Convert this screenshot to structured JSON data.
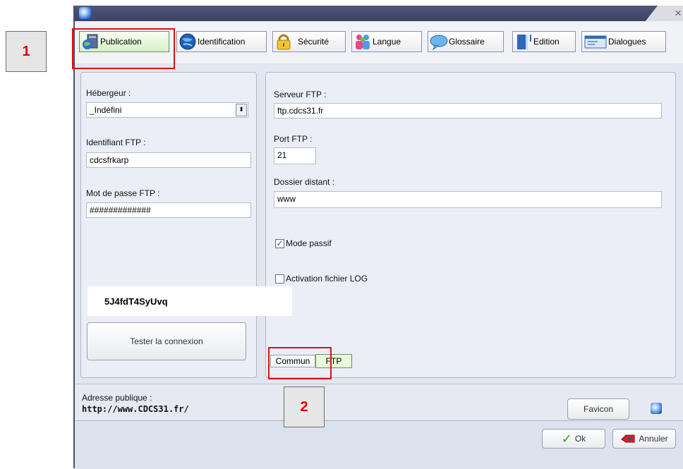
{
  "callouts": {
    "one": "1",
    "two": "2"
  },
  "window": {
    "close_glyph": "×"
  },
  "tabs": [
    {
      "label": "Publication",
      "icon": "publication-icon"
    },
    {
      "label": "Identification",
      "icon": "globe-icon"
    },
    {
      "label": "Sécurité",
      "icon": "lock-icon"
    },
    {
      "label": "Langue",
      "icon": "people-icon"
    },
    {
      "label": "Glossaire",
      "icon": "speech-bubble-icon"
    },
    {
      "label": "Edition",
      "icon": "edit-icon"
    },
    {
      "label": "Dialogues",
      "icon": "dialog-icon"
    }
  ],
  "left_panel": {
    "host_label": "Hébergeur :",
    "host_value": "_Indéfini",
    "ftp_id_label": "Identifiant FTP :",
    "ftp_id_value": "cdcsfrkarp",
    "ftp_pass_label": "Mot de passe FTP :",
    "ftp_pass_value": "#############",
    "overlay_code": "5J4fdT4SyUvq",
    "test_button": "Tester la connexion"
  },
  "right_panel": {
    "server_label": "Serveur FTP :",
    "server_value": "ftp.cdcs31.fr",
    "port_label": "Port FTP :",
    "port_value": "21",
    "folder_label": "Dossier distant :",
    "folder_value": "www",
    "passive_label": "Mode passif",
    "passive_checked": true,
    "log_label": "Activation fichier LOG",
    "log_checked": false
  },
  "subtabs": [
    "Commun",
    "FTP"
  ],
  "footer": {
    "address_label": "Adresse publique :",
    "address_value": "http://www.CDCS31.fr/",
    "favicon_button": "Favicon"
  },
  "buttons": {
    "ok": "Ok",
    "cancel": "Annuler"
  },
  "colors": {
    "accent_red": "#e01010",
    "active_tab": "#d8f0c8"
  }
}
